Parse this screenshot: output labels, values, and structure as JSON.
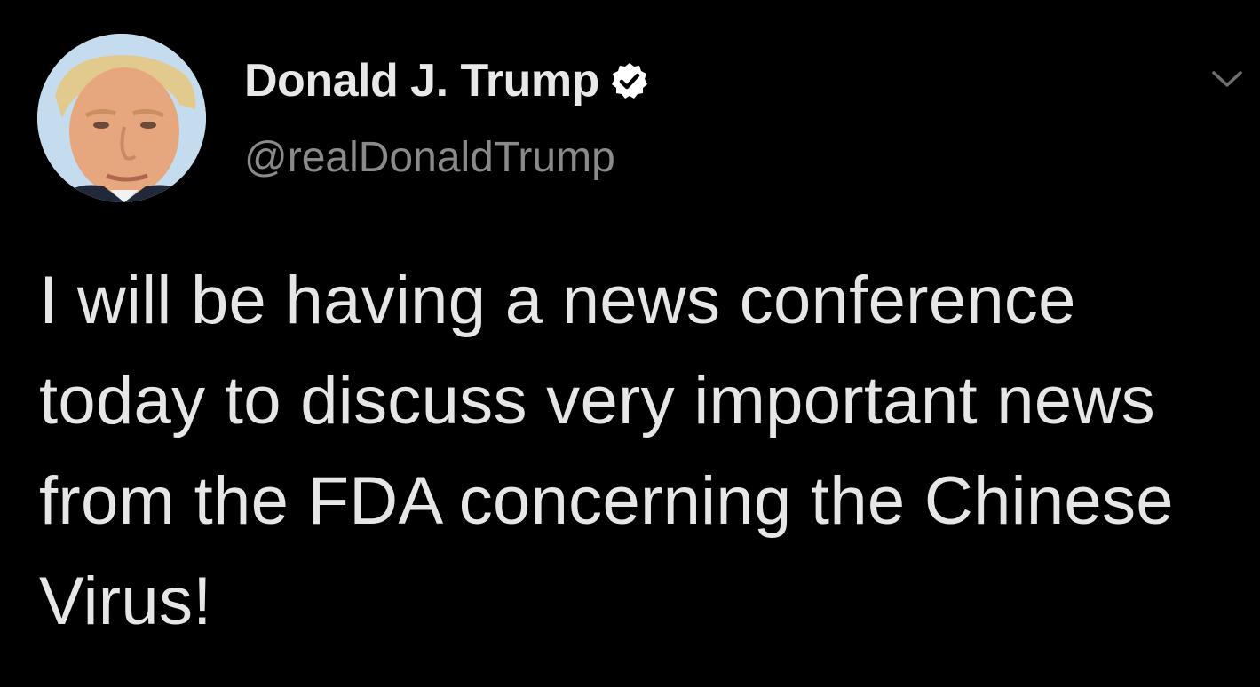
{
  "tweet": {
    "author": {
      "display_name": "Donald J. Trump",
      "handle": "@realDonaldTrump",
      "verified": true,
      "verified_icon": "verified-badge-icon",
      "avatar": "profile-photo"
    },
    "menu_icon": "chevron-down-icon",
    "text": "I will be having a news conference today to discuss very important news from the FDA concerning the Chinese Virus!"
  },
  "colors": {
    "background": "#000000",
    "primary_text": "#e6e6e6",
    "secondary_text": "#8a8a8a",
    "badge": "#ffffff"
  }
}
